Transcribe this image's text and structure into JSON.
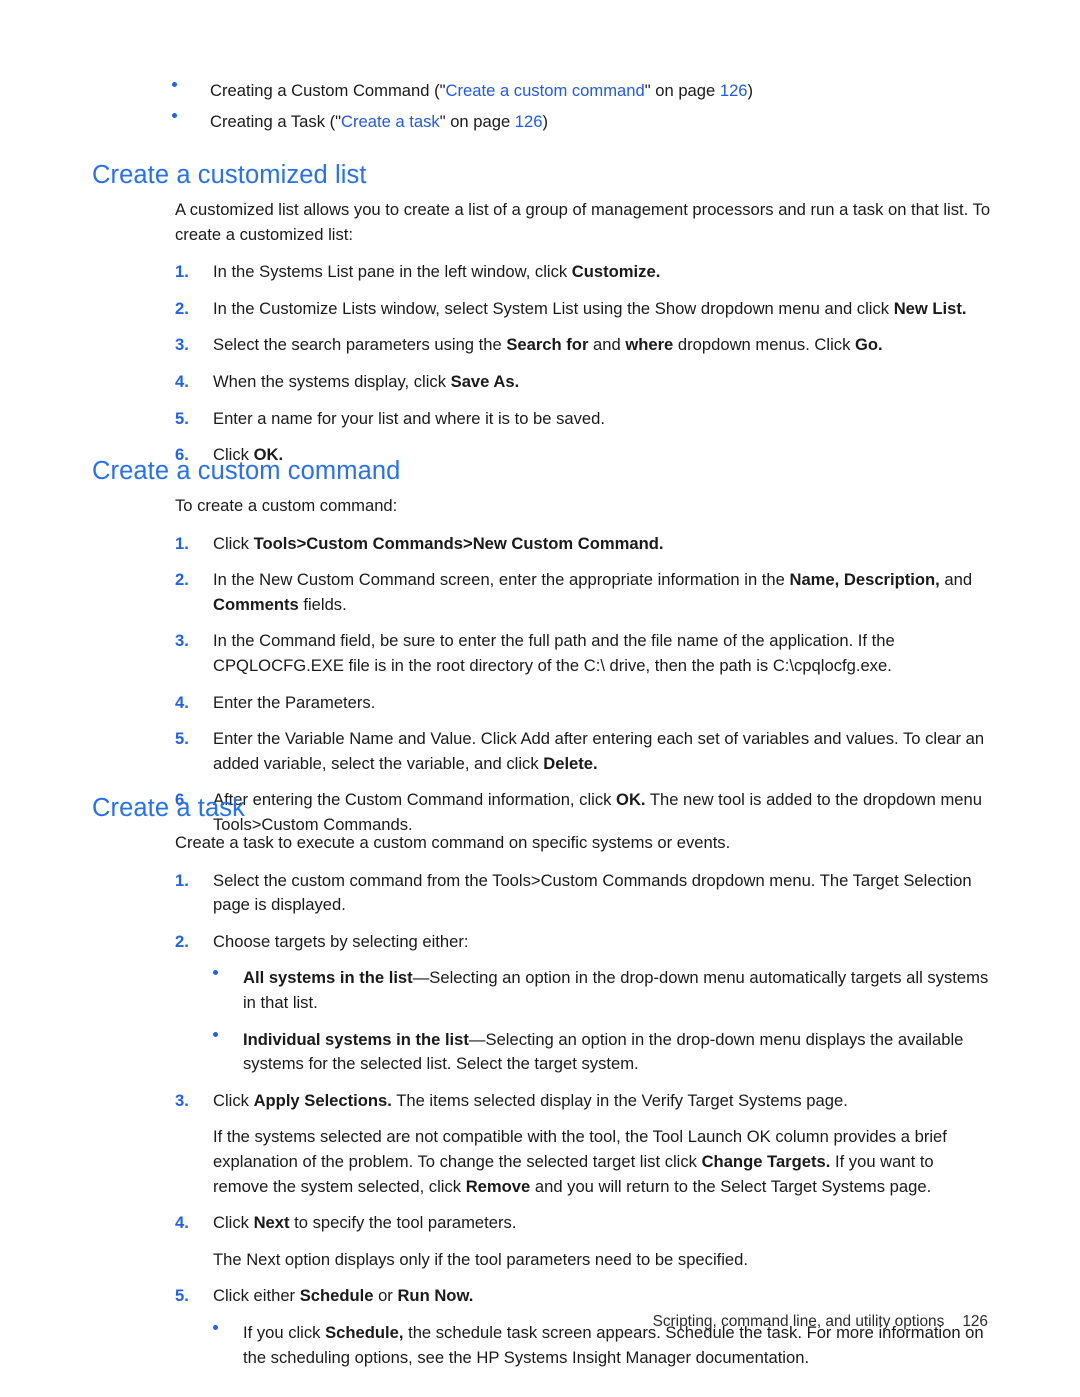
{
  "document": {
    "top_bullets": [
      {
        "pre": "Creating a Custom Command (\"",
        "link": "Create a custom command",
        "mid": "\" on page ",
        "page": "126",
        "post": ")"
      },
      {
        "pre": "Creating a Task (\"",
        "link": "Create a task",
        "mid": "\" on page ",
        "page": "126",
        "post": ")"
      }
    ],
    "sections": [
      {
        "heading": "Create a customized list",
        "intro": "A customized list allows you to create a list of a group of management processors and run a task on that list. To create a customized list:",
        "steps": [
          {
            "num": "1.",
            "text_pre": "In the Systems List pane in the left window, click ",
            "text_bold": "Customize.",
            "text_post": ""
          },
          {
            "num": "2.",
            "text_pre": "In the Customize Lists window, select System List using the Show dropdown menu and click ",
            "text_bold": "New List.",
            "text_post": ""
          },
          {
            "num": "3.",
            "text_pre": "Select the search parameters using the ",
            "text_bold": "Search for",
            "text_mid": " and ",
            "text_bold2": "where",
            "text_post": " dropdown menus. Click ",
            "text_bold3": "Go."
          },
          {
            "num": "4.",
            "text_pre": "When the systems display, click ",
            "text_bold": "Save As.",
            "text_post": ""
          },
          {
            "num": "5.",
            "text_pre": "Enter a name for your list and where it is to be saved.",
            "text_bold": "",
            "text_post": ""
          },
          {
            "num": "6.",
            "text_pre": "Click ",
            "text_bold": "OK.",
            "text_post": ""
          }
        ]
      },
      {
        "heading": "Create a custom command",
        "intro": "To create a custom command:",
        "steps": [
          {
            "num": "1.",
            "text_pre": "Click ",
            "text_bold": "Tools>Custom Commands>New Custom Command.",
            "text_post": ""
          },
          {
            "num": "2.",
            "text_pre": "In the New Custom Command screen, enter the appropriate information in the ",
            "text_bold": "Name, Description,",
            "text_mid": " and ",
            "text_bold2": "Comments",
            "text_post": " fields."
          },
          {
            "num": "3.",
            "text_pre": "In the Command field, be sure to enter the full path and the file name of the application. If the CPQLOCFG.EXE file is in the root directory of the C:\\ drive, then the path is C:\\cpqlocfg.exe.",
            "text_bold": "",
            "text_post": ""
          },
          {
            "num": "4.",
            "text_pre": "Enter the Parameters.",
            "text_bold": "",
            "text_post": ""
          },
          {
            "num": "5.",
            "text_pre": "Enter the Variable Name and Value. Click Add after entering each set of variables and values. To clear an added variable, select the variable, and click ",
            "text_bold": "Delete.",
            "text_post": ""
          },
          {
            "num": "6.",
            "text_pre": "After entering the Custom Command information, click ",
            "text_bold": "OK.",
            "text_post": " The new tool is added to the dropdown menu Tools>Custom Commands."
          }
        ]
      },
      {
        "heading": "Create a task",
        "intro": "Create a task to execute a custom command on specific systems or events.",
        "steps": [
          {
            "num": "1.",
            "text_pre": "Select the custom command from the Tools>Custom Commands dropdown menu. The Target Selection page is displayed.",
            "text_bold": "",
            "text_post": ""
          },
          {
            "num": "2.",
            "text_pre": "Choose targets by selecting either:",
            "text_bold": "",
            "text_post": ""
          }
        ],
        "target_bullets": [
          {
            "bold": "All systems in the list",
            "rest": "—Selecting an option in the drop-down menu automatically targets all systems in that list."
          },
          {
            "bold": "Individual systems in the list",
            "rest": "—Selecting an option in the drop-down menu displays the available systems for the selected list. Select the target system."
          }
        ],
        "step3": {
          "num": "3.",
          "pre": "Click ",
          "bold": "Apply Selections.",
          "post": " The items selected display in the Verify Target Systems page."
        },
        "step3_extra": {
          "p1": "If the systems selected are not compatible with the tool, the Tool Launch OK column provides a brief explanation of the problem. To change the selected target list click ",
          "b1": "Change Targets.",
          "p2": " If you want to remove the system selected, click ",
          "b2": "Remove",
          "p3": " and you will return to the Select Target Systems page."
        },
        "step4": {
          "num": "4.",
          "pre": "Click ",
          "bold": "Next",
          "post": " to specify the tool parameters."
        },
        "step4_extra": "The Next option displays only if the tool parameters need to be specified.",
        "step5": {
          "num": "5.",
          "pre": "Click either ",
          "bold": "Schedule",
          "mid": " or ",
          "bold2": "Run Now."
        },
        "schedule_bullets": [
          {
            "pre": "If you click ",
            "bold": "Schedule,",
            "post": " the schedule task screen appears. Schedule the task. For more information on the scheduling options, see the HP Systems Insight Manager documentation."
          }
        ]
      }
    ],
    "footer": {
      "title": "Scripting, command line, and utility options",
      "page": "126"
    },
    "colors": {
      "heading_blue": "#2571f2",
      "link_blue": "#2059ef",
      "marker_blue": "#1f62f0",
      "body_text": "#1a1a1a"
    }
  }
}
